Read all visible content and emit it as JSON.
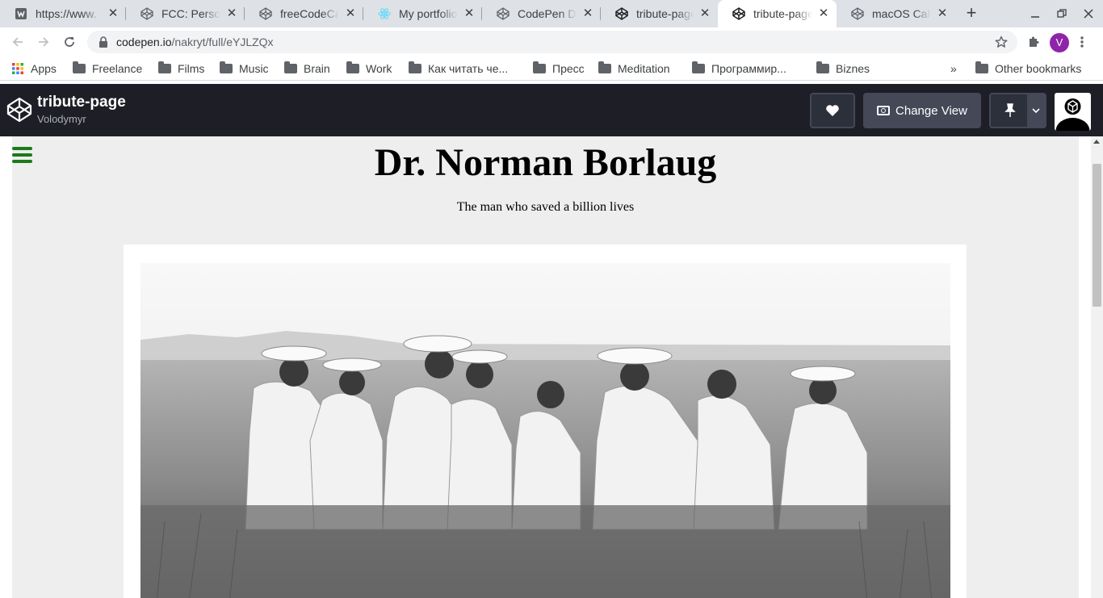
{
  "browser": {
    "tabs": [
      {
        "title": "https://www.",
        "icon": "w-icon"
      },
      {
        "title": "FCC: Personal",
        "icon": "codepen-icon"
      },
      {
        "title": "freeCodeCamp",
        "icon": "codepen-icon"
      },
      {
        "title": "My portfolio",
        "icon": "react-icon"
      },
      {
        "title": "CodePen Dashboard",
        "icon": "codepen-icon"
      },
      {
        "title": "tribute-page",
        "icon": "codepen-icon"
      },
      {
        "title": "tribute-page",
        "icon": "codepen-icon",
        "active": true
      },
      {
        "title": "macOS Calculator",
        "icon": "codepen-icon"
      }
    ],
    "url_host": "codepen.io",
    "url_path": "/nakryt/full/eYJLZQx",
    "profile_initial": "V",
    "profile_color": "#8e24aa",
    "bookmarks": [
      {
        "label": "Apps",
        "icon": "apps-grid-icon"
      },
      {
        "label": "Freelance",
        "icon": "folder-icon"
      },
      {
        "label": "Films",
        "icon": "folder-icon"
      },
      {
        "label": "Music",
        "icon": "folder-icon"
      },
      {
        "label": "Brain",
        "icon": "folder-icon"
      },
      {
        "label": "Work",
        "icon": "folder-icon"
      },
      {
        "label": "Как читать че...",
        "icon": "folder-icon"
      },
      {
        "label": "Пресс",
        "icon": "folder-icon"
      },
      {
        "label": "Meditation",
        "icon": "folder-icon"
      },
      {
        "label": "Программир...",
        "icon": "folder-icon"
      },
      {
        "label": "Biznes",
        "icon": "folder-icon"
      }
    ],
    "overflow_chevron": "»",
    "other_bookmarks": "Other bookmarks"
  },
  "codepen": {
    "pen_title": "tribute-page",
    "author": "Volodymyr",
    "change_view_label": "Change View",
    "header_bg": "#1e1f26"
  },
  "page": {
    "title": "Dr. Norman Borlaug",
    "subtitle": "The man who saved a billion lives",
    "menu_color": "#1a7a1a"
  }
}
